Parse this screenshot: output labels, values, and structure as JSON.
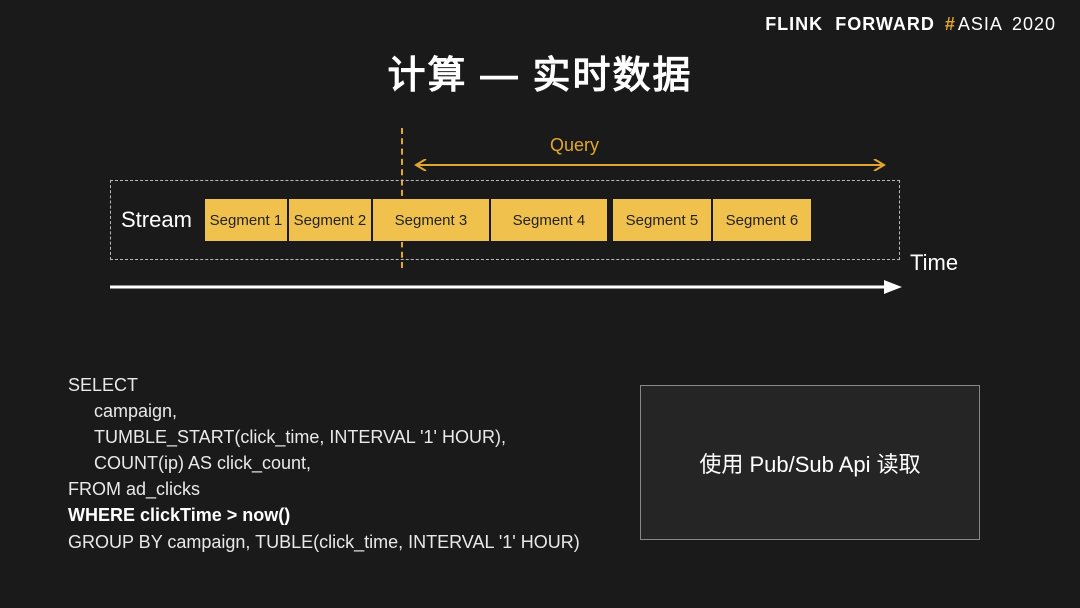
{
  "brand": {
    "flink": "FLINK",
    "forward": "FORWARD",
    "hash": "#",
    "asia": "ASIA",
    "year": "2020"
  },
  "title": "计算 — 实时数据",
  "diagram": {
    "query_label": "Query",
    "stream_label": "Stream",
    "time_label": "Time",
    "segments": [
      "Segment 1",
      "Segment 2",
      "Segment 3",
      "Segment 4",
      "Segment 5",
      "Segment 6"
    ]
  },
  "sql": {
    "l1": "SELECT",
    "l2": "campaign,",
    "l3": "TUMBLE_START(click_time, INTERVAL '1' HOUR),",
    "l4": "COUNT(ip) AS click_count,",
    "l5": "FROM ad_clicks",
    "l6": "WHERE clickTime > now()",
    "l7": "GROUP BY campaign, TUBLE(click_time, INTERVAL '1' HOUR)"
  },
  "right_box": "使用 Pub/Sub Api 读取"
}
